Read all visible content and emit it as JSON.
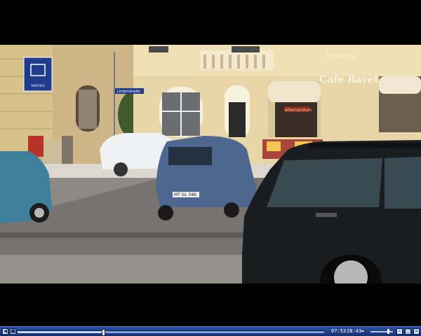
{
  "video": {
    "scene_signs": {
      "museum_sign": "SKOPOLIS",
      "street_sign": "Lindenstraße",
      "cafe_name": "Cafe Bayet",
      "awning_text": "Allemandum",
      "building_lettering": "Kreuzne",
      "license_plate": "MT GL 586"
    }
  },
  "player": {
    "elapsed_time": "07:53",
    "total_time": "28:43",
    "progress_fraction": 0.28,
    "volume_fraction": 0.8,
    "buttons": {
      "prev_icon": "skip-back-icon",
      "stop_icon": "stop-icon",
      "volume_icon": "speaker-icon",
      "zoom_icon": "magnifier-icon",
      "fullscreen_icon": "fullscreen-icon",
      "close_icon": "close-icon"
    }
  },
  "colors": {
    "control_bar": "#1e3c84",
    "seek_track": "#7fa0e0"
  }
}
